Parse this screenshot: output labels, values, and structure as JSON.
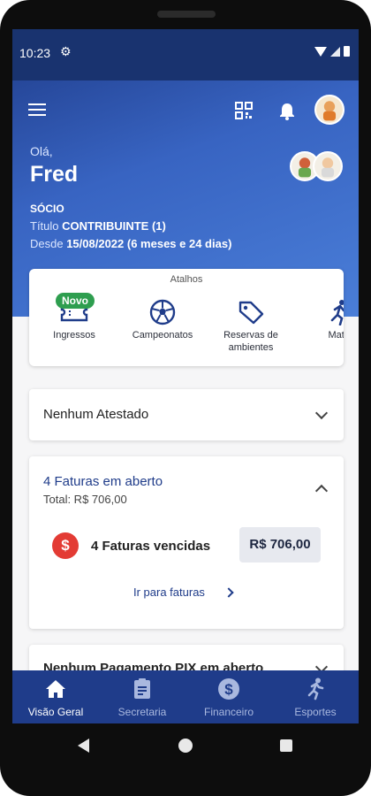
{
  "status_bar": {
    "time": "10:23",
    "settings_icon": "gear-icon"
  },
  "header": {
    "icons": [
      "menu-icon",
      "qr-code-icon",
      "bell-icon",
      "avatar"
    ],
    "greeting": "Olá,",
    "user_name": "Fred",
    "membership": "SÓCIO",
    "title_label": "Título",
    "title_value": "CONTRIBUINTE (1)",
    "since_label": "Desde",
    "since_value": "15/08/2022 (6 meses e 24 dias)"
  },
  "shortcuts": {
    "title": "Atalhos",
    "items": [
      {
        "label": "Ingressos",
        "icon": "ticket-icon",
        "badge": "Novo"
      },
      {
        "label": "Campeonatos",
        "icon": "soccer-ball-icon"
      },
      {
        "label": "Reservas de ambientes",
        "icon": "tag-icon"
      },
      {
        "label": "Matrí",
        "icon": "running-icon"
      }
    ]
  },
  "cards": {
    "atestado": {
      "title": "Nenhum Atestado"
    },
    "faturas": {
      "title": "4 Faturas em aberto",
      "total": "Total: R$ 706,00",
      "overdue_label": "4 Faturas vencidas",
      "overdue_amount": "R$ 706,00",
      "link": "Ir para faturas"
    },
    "pix": {
      "title": "Nenhum Pagamento PIX em aberto"
    }
  },
  "bottom_nav": [
    {
      "label": "Visão Geral",
      "icon": "home-icon",
      "active": true
    },
    {
      "label": "Secretaria",
      "icon": "clipboard-icon",
      "active": false
    },
    {
      "label": "Financeiro",
      "icon": "dollar-icon",
      "active": false
    },
    {
      "label": "Esportes",
      "icon": "running-icon",
      "active": false
    }
  ],
  "colors": {
    "primary": "#1f3c8a",
    "accent_green": "#2e9e4f",
    "alert_red": "#e33b34"
  }
}
